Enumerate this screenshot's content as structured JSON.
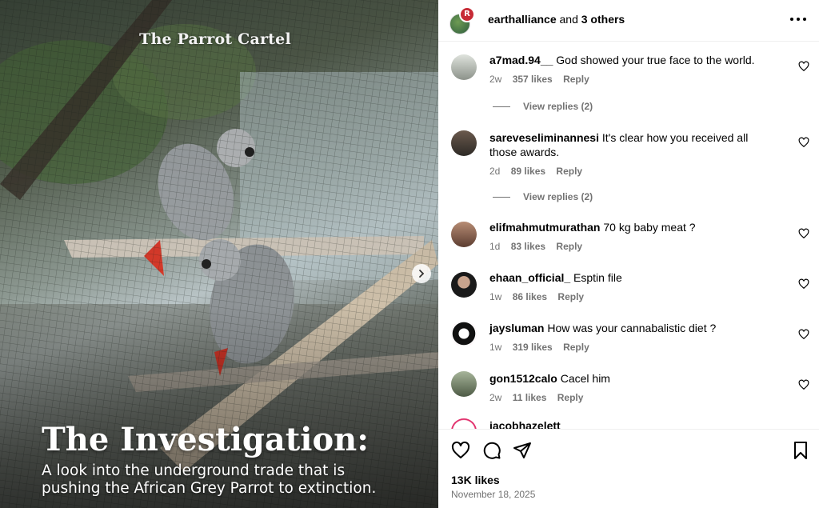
{
  "media": {
    "top_title": "The Parrot Cartel",
    "big_title": "The Investigation:",
    "subtitle_line1": "A look into the underground trade that is",
    "subtitle_line2": "pushing the African Grey Parrot to extinction.",
    "next_icon": "chevron-right-icon"
  },
  "header": {
    "author": "earthalliance",
    "and_text": " and ",
    "others": "3 others",
    "more_icon": "more-horizontal-icon"
  },
  "comments": [
    {
      "user": "a7mad.94__",
      "text": "God showed your true face to the world.",
      "age": "2w",
      "likes": "357 likes",
      "reply": "Reply",
      "view_replies": "View replies (2)"
    },
    {
      "user": "sareveseliminannesi",
      "text": "It's clear how you received all those awards.",
      "age": "2d",
      "likes": "89 likes",
      "reply": "Reply",
      "view_replies": "View replies (2)"
    },
    {
      "user": "elifmahmutmurathan",
      "text": "70 kg baby meat ?",
      "age": "1d",
      "likes": "83 likes",
      "reply": "Reply"
    },
    {
      "user": "ehaan_official_",
      "text": "Esptin file",
      "age": "1w",
      "likes": "86 likes",
      "reply": "Reply"
    },
    {
      "user": "jaysluman",
      "text": "How was your cannabalistic diet ?",
      "age": "1w",
      "likes": "319 likes",
      "reply": "Reply"
    },
    {
      "user": "gon1512calo",
      "text": "Cacel him",
      "age": "2w",
      "likes": "11 likes",
      "reply": "Reply"
    },
    {
      "user": "jacobhazelett",
      "text": "",
      "age": "",
      "likes": "",
      "reply": ""
    }
  ],
  "footer": {
    "likes": "13K likes",
    "date": "November 18, 2025"
  }
}
